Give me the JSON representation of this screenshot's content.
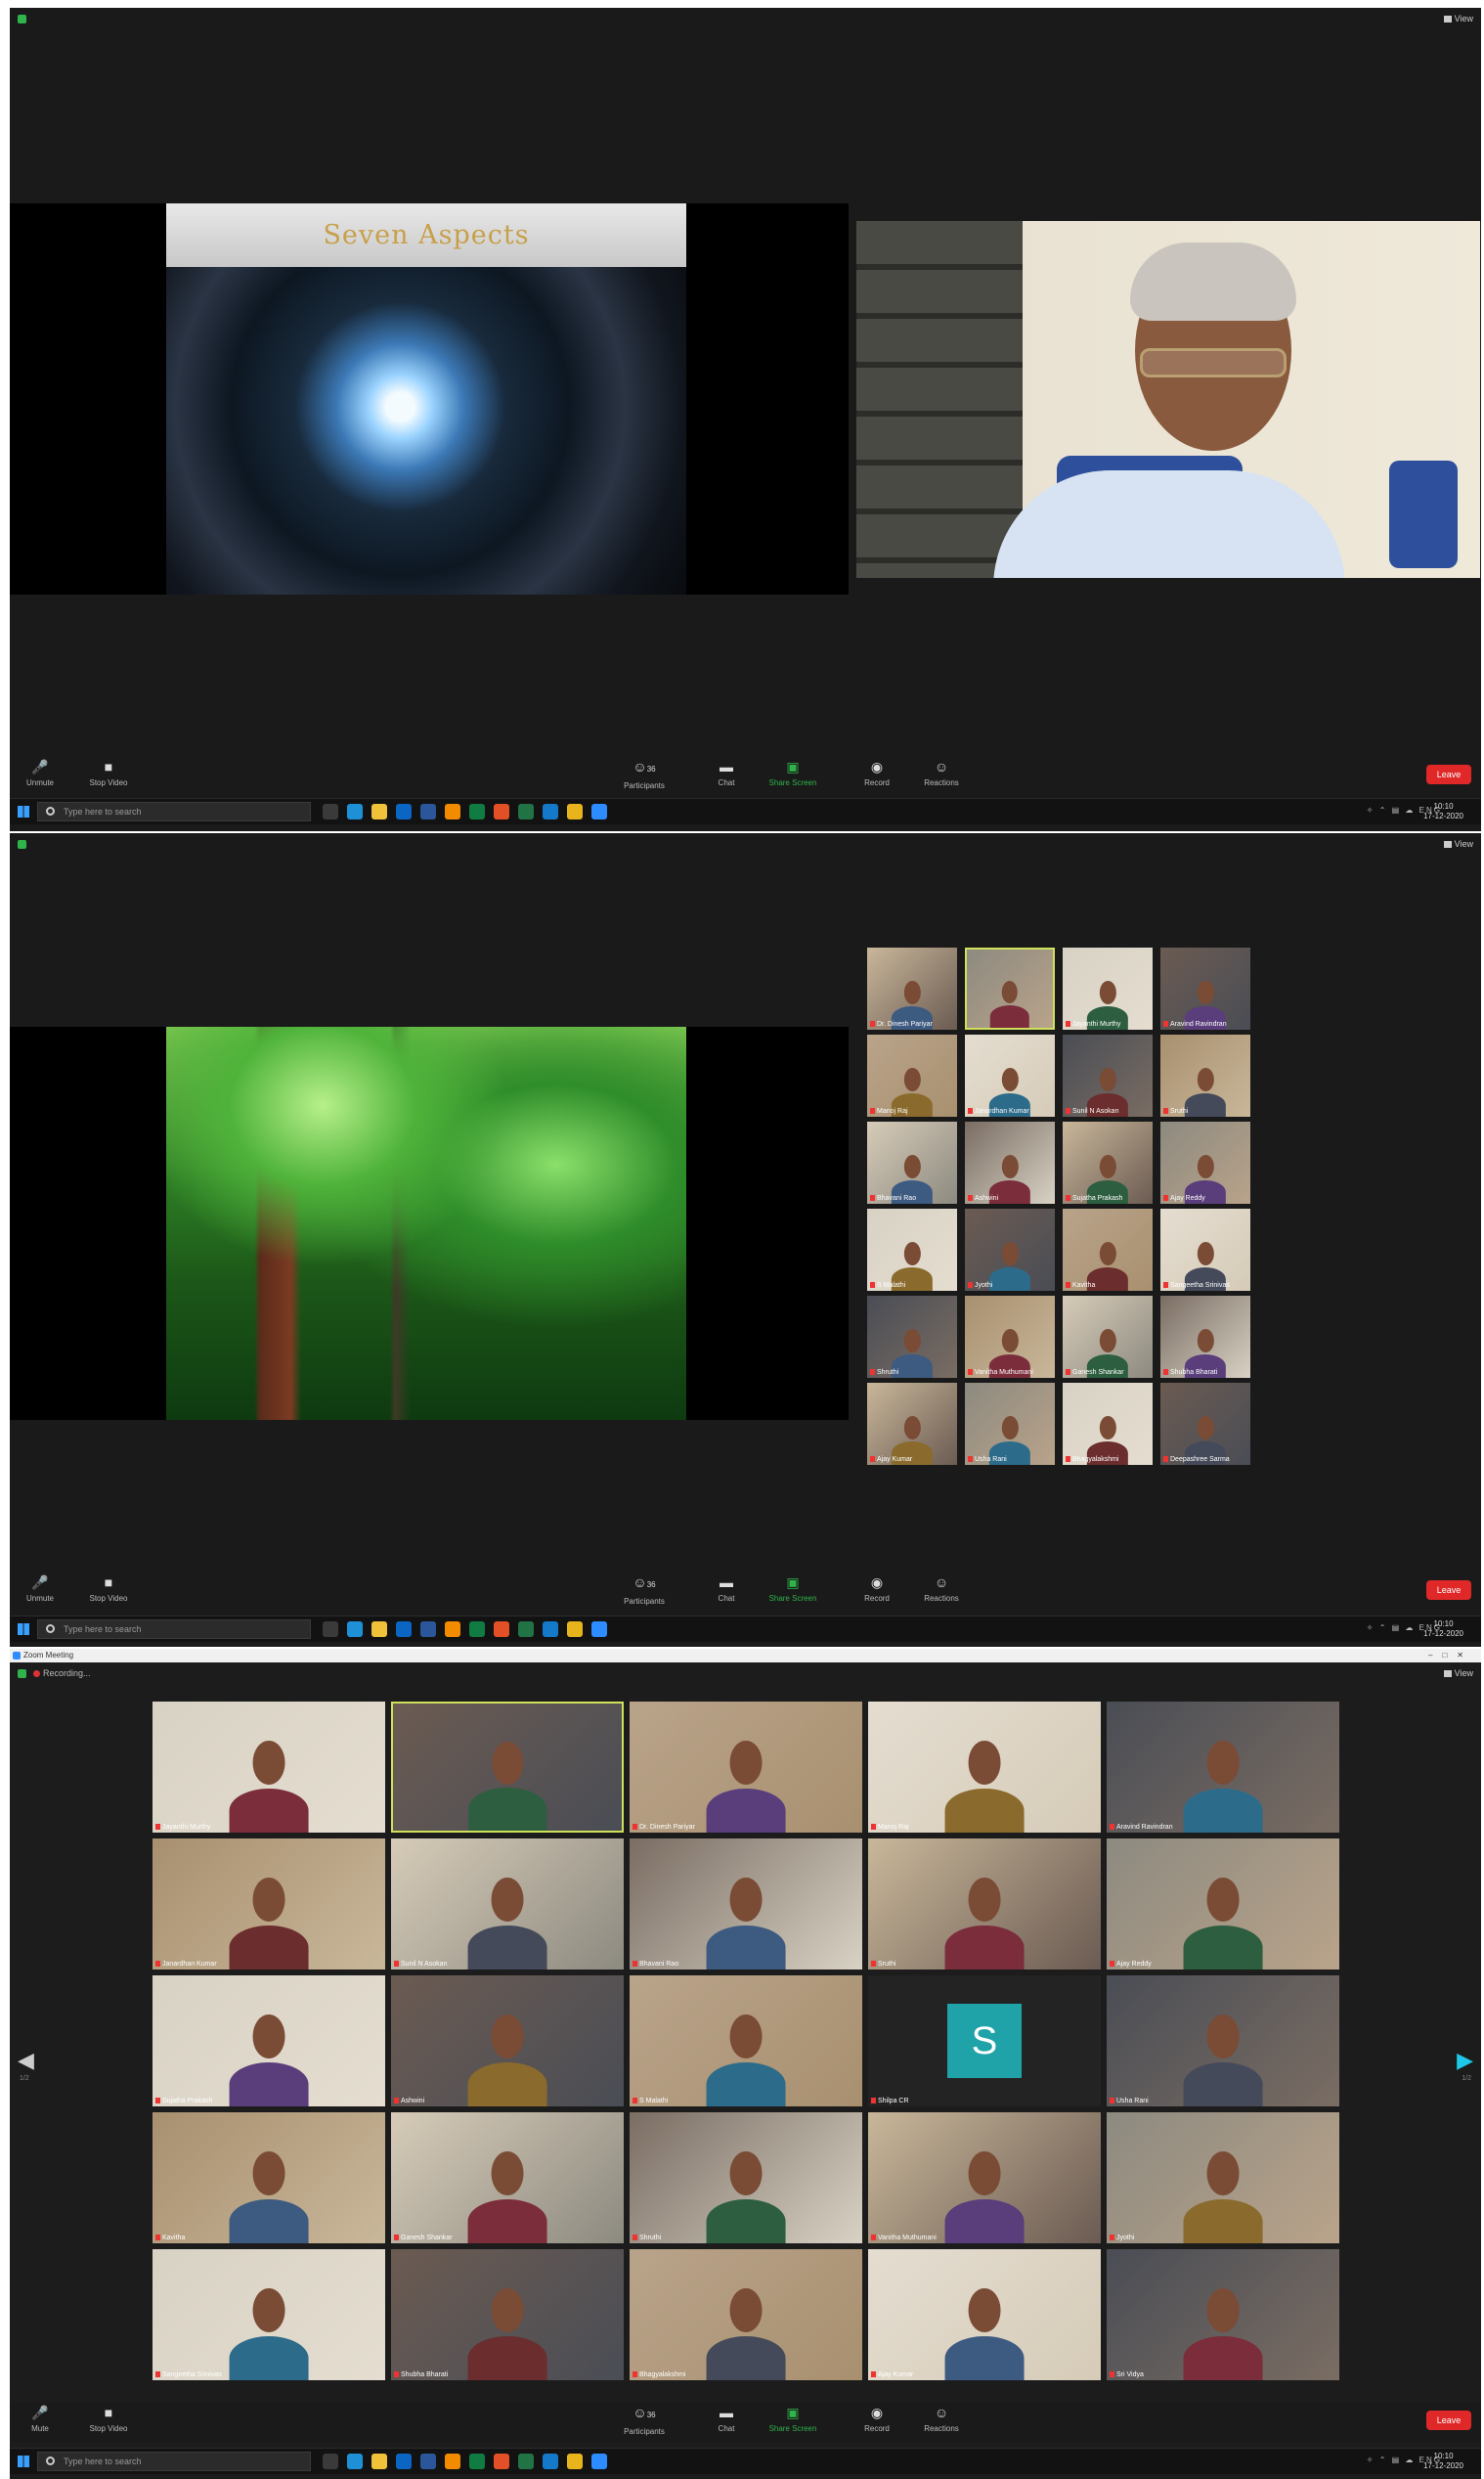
{
  "common": {
    "view_label": "View",
    "toolbar": {
      "mute": "Unmute",
      "mute_s3": "Mute",
      "video": "Stop Video",
      "participants": "Participants",
      "participants_count": "36",
      "chat": "Chat",
      "share": "Share Screen",
      "record": "Record",
      "reactions": "Reactions",
      "end": "Leave"
    },
    "search_placeholder": "Type here to search",
    "clock_time": "10:10",
    "clock_date": "17-12-2020",
    "lang": "ENG"
  },
  "screen1": {
    "slide_title": "Seven Aspects"
  },
  "screen2": {
    "tiles": [
      {
        "name": "Dr. Dinesh Pariyar"
      },
      {
        "name": ""
      },
      {
        "name": "Jayanthi Murthy"
      },
      {
        "name": "Aravind Ravindran"
      },
      {
        "name": "Manoj Raj"
      },
      {
        "name": "Janardhan Kumar"
      },
      {
        "name": "Sunil N Asokan"
      },
      {
        "name": "Sruthi"
      },
      {
        "name": "Bhavani Rao"
      },
      {
        "name": "Ashwini"
      },
      {
        "name": "Sujatha Prakash"
      },
      {
        "name": "Ajay Reddy"
      },
      {
        "name": "S Malathi"
      },
      {
        "name": "Jyothi"
      },
      {
        "name": "Kavitha"
      },
      {
        "name": "Sangeetha Srinivas"
      },
      {
        "name": "Shruthi"
      },
      {
        "name": "Vanitha Muthumani"
      },
      {
        "name": "Ganesh Shankar"
      },
      {
        "name": "Shubha Bharati"
      },
      {
        "name": "Ajay Kumar"
      },
      {
        "name": "Usha Rani"
      },
      {
        "name": "Bhagyalakshmi"
      },
      {
        "name": "Deepashree Sarma"
      }
    ]
  },
  "screen3": {
    "window_title": "Zoom Meeting",
    "recording": "Recording...",
    "s_avatar_letter": "S",
    "tiles": [
      {
        "name": "Jayanthi Murthy"
      },
      {
        "name": ""
      },
      {
        "name": "Dr. Dinesh Pariyar"
      },
      {
        "name": "Manoj Raj"
      },
      {
        "name": "Aravind Ravindran"
      },
      {
        "name": "Janardhan Kumar"
      },
      {
        "name": "Sunil N Asokan"
      },
      {
        "name": "Bhavani Rao"
      },
      {
        "name": "Sruthi"
      },
      {
        "name": "Ajay Reddy"
      },
      {
        "name": "Sujatha Prakash"
      },
      {
        "name": "Ashwini"
      },
      {
        "name": "S Malathi"
      },
      {
        "name": "Shilpa CR"
      },
      {
        "name": "Usha Rani"
      },
      {
        "name": "Kavitha"
      },
      {
        "name": "Ganesh Shankar"
      },
      {
        "name": "Shruthi"
      },
      {
        "name": "Vanitha Muthumani"
      },
      {
        "name": "Jyothi"
      },
      {
        "name": "Sangeetha Srinivas"
      },
      {
        "name": "Shubha Bharati"
      },
      {
        "name": "Bhagyalakshmi"
      },
      {
        "name": "Ajay Kumar"
      },
      {
        "name": "Sri Vidya"
      }
    ],
    "page_left": "1/2",
    "page_right": "1/2"
  }
}
